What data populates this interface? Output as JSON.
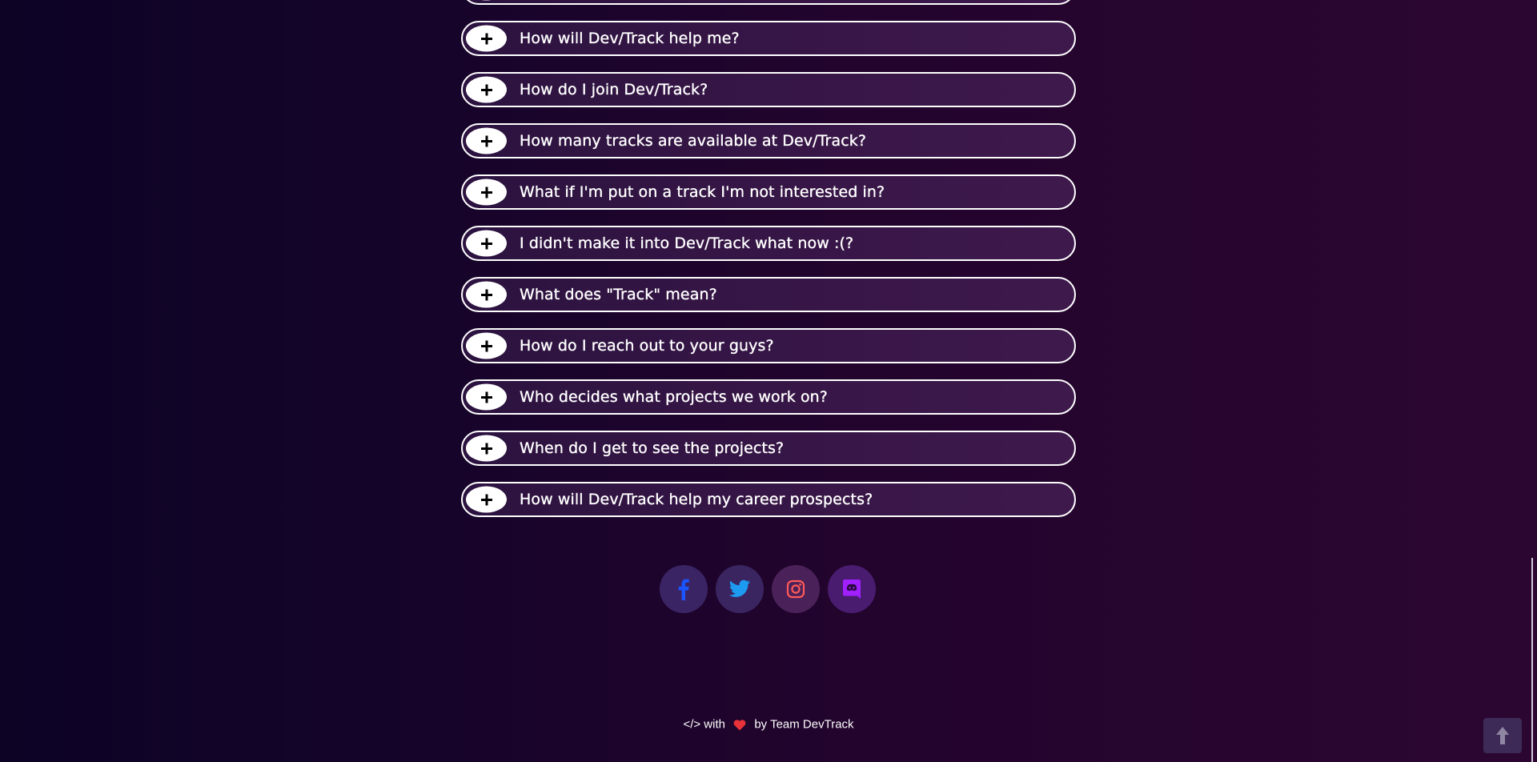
{
  "faq": {
    "items": [
      {
        "question": ""
      },
      {
        "question": "How will Dev/Track help me?"
      },
      {
        "question": "How do I join Dev/Track?"
      },
      {
        "question": "How many tracks are available at Dev/Track?"
      },
      {
        "question": "What if I'm put on a track I'm not interested in?"
      },
      {
        "question": "I didn't make it into Dev/Track what now :(?"
      },
      {
        "question": "What does \"Track\" mean?"
      },
      {
        "question": "How do I reach out to your guys?"
      },
      {
        "question": "Who decides what projects we work on?"
      },
      {
        "question": "When do I get to see the projects?"
      },
      {
        "question": "How will Dev/Track help my career prospects?"
      }
    ]
  },
  "social": [
    {
      "icon": "facebook-icon",
      "color": "#1a55ff"
    },
    {
      "icon": "twitter-icon",
      "color": "#1d9bf0"
    },
    {
      "icon": "instagram-icon",
      "color": "#ff5a5a"
    },
    {
      "icon": "discord-icon",
      "color": "#a020ff"
    }
  ],
  "footer": {
    "code_symbol": "</> with",
    "heart_color": "#e8323a",
    "by_text": "by Team DevTrack"
  },
  "scroll_top": {
    "icon": "arrow-up-icon"
  }
}
